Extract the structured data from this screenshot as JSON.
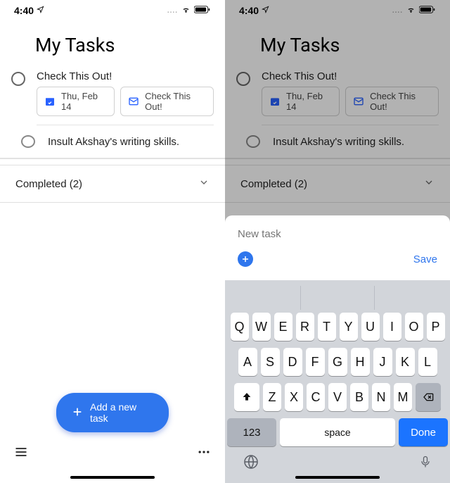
{
  "statusbar": {
    "time": "4:40"
  },
  "header": {
    "title": "My Tasks"
  },
  "task1": {
    "title": "Check This Out!",
    "chip_date": "Thu, Feb 14",
    "chip_link": "Check This Out!"
  },
  "subtask1": {
    "label": "Insult Akshay's writing skills."
  },
  "completed": {
    "label": "Completed (2)"
  },
  "fab": {
    "label": "Add a new task"
  },
  "sheet": {
    "placeholder": "New task",
    "save": "Save"
  },
  "keyboard": {
    "row1": [
      "Q",
      "W",
      "E",
      "R",
      "T",
      "Y",
      "U",
      "I",
      "O",
      "P"
    ],
    "row2": [
      "A",
      "S",
      "D",
      "F",
      "G",
      "H",
      "J",
      "K",
      "L"
    ],
    "row3": [
      "Z",
      "X",
      "C",
      "V",
      "B",
      "N",
      "M"
    ],
    "num": "123",
    "space": "space",
    "done": "Done"
  }
}
